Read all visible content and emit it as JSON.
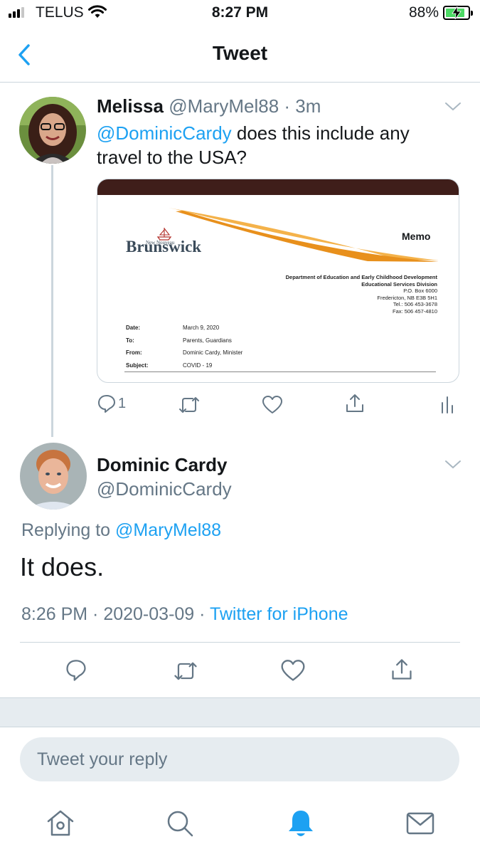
{
  "status_bar": {
    "carrier": "TELUS",
    "time": "8:27 PM",
    "battery_percent": "88%",
    "battery_level": 0.88,
    "battery_color": "#4cd964"
  },
  "nav": {
    "back_icon": "chevron-left-icon",
    "title": "Tweet"
  },
  "colors": {
    "accent": "#1da1f2",
    "secondary_text": "#657786",
    "border": "#ccd6dd",
    "memo_bar": "#3f1e1a"
  },
  "parent_tweet": {
    "name": "Melissa",
    "handle": "@MaryMel88",
    "time": "3m",
    "mention": "@DominicCardy",
    "text": " does this include any travel to the USA?",
    "media": {
      "memo_title": "Memo",
      "logo_small": "New Nouveau",
      "logo": "Brunswick",
      "department": "Department of Education and Early Childhood Development",
      "division": "Educational Services Division",
      "address_lines": [
        "P.O. Box 6000",
        "Fredericton, NB E3B 5H1",
        "Tel.: 506 453-3678",
        "Fax: 506 457-4810"
      ],
      "fields": [
        {
          "label": "Date:",
          "value": "March 9, 2020"
        },
        {
          "label": "To:",
          "value": "Parents, Guardians"
        },
        {
          "label": "From:",
          "value": "Dominic Cardy, Minister"
        },
        {
          "label": "Subject:",
          "value": "COVID - 19"
        }
      ]
    },
    "actions": {
      "reply_count": "1"
    }
  },
  "reply_tweet": {
    "name": "Dominic Cardy",
    "handle": "@DominicCardy",
    "replying_prefix": "Replying to ",
    "replying_to": "@MaryMel88",
    "text": "It does.",
    "timestamp": "8:26 PM · 2020-03-09 · ",
    "source": "Twitter for iPhone"
  },
  "composer": {
    "placeholder": "Tweet your reply"
  },
  "tab_bar": {
    "tabs": [
      "home-icon",
      "search-icon",
      "notifications-icon",
      "messages-icon"
    ],
    "active": "notifications-icon"
  }
}
